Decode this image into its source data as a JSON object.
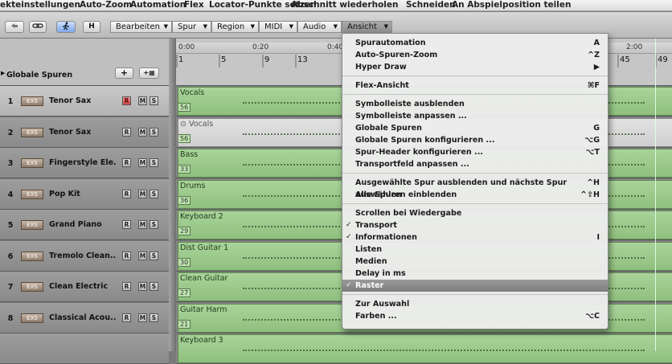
{
  "menubar": [
    "ekteinstellungen",
    "Auto-Zoom",
    "Automation",
    "Flex",
    "Locator-Punkte setzen",
    "Abschnitt wiederholen",
    "Schneiden",
    "An Abspielposition teilen"
  ],
  "toolbar": {
    "h_label": "H",
    "menus": [
      "Bearbeiten",
      "Spur",
      "Region",
      "MIDI",
      "Audio",
      "Ansicht"
    ]
  },
  "global": {
    "label": "Globale Spuren",
    "plus": "+",
    "grid": "+▦"
  },
  "ruler": {
    "times": [
      "0:00",
      "0:20",
      "0:40",
      "2:00"
    ],
    "bars": [
      "1",
      "5",
      "9",
      "13",
      "45",
      "49"
    ]
  },
  "tracks": [
    {
      "num": "1",
      "name": "Tenor Sax",
      "rec": true,
      "region": "Vocals",
      "rnum": "56",
      "grey": false
    },
    {
      "num": "2",
      "name": "Tenor Sax",
      "rec": false,
      "region": "Vocals",
      "rnum": "56",
      "grey": true
    },
    {
      "num": "3",
      "name": "Fingerstyle Ele...",
      "rec": false,
      "region": "Bass",
      "rnum": "33",
      "grey": false
    },
    {
      "num": "4",
      "name": "Pop Kit",
      "rec": false,
      "region": "Drums",
      "rnum": "36",
      "grey": false
    },
    {
      "num": "5",
      "name": "Grand Piano",
      "rec": false,
      "region": "Keyboard 2",
      "rnum": "29",
      "grey": false
    },
    {
      "num": "6",
      "name": "Tremolo Clean...",
      "rec": false,
      "region": "Dist Guitar 1",
      "rnum": "30",
      "grey": false
    },
    {
      "num": "7",
      "name": "Clean Electric",
      "rec": false,
      "region": "Clean Guitar",
      "rnum": "27",
      "grey": false
    },
    {
      "num": "8",
      "name": "Classical Acou...",
      "rec": false,
      "region": "Guitar Harm",
      "rnum": "21",
      "grey": false
    },
    {
      "num": "",
      "name": "",
      "rec": false,
      "region": "Keyboard 3",
      "rnum": "",
      "grey": false
    }
  ],
  "btn": {
    "r": "R",
    "m": "M",
    "s": "S",
    "exs": "EXS"
  },
  "dropdown": [
    {
      "label": "Spurautomation",
      "sc": "A"
    },
    {
      "label": "Auto-Spuren-Zoom",
      "sc": "^Z"
    },
    {
      "label": "Hyper Draw",
      "sc": "▶"
    },
    {
      "sep": true
    },
    {
      "label": "Flex-Ansicht",
      "sc": "⌘F"
    },
    {
      "sep": true
    },
    {
      "label": "Symbolleiste ausblenden",
      "sc": ""
    },
    {
      "label": "Symbolleiste anpassen ...",
      "sc": ""
    },
    {
      "label": "Globale Spuren",
      "sc": "G"
    },
    {
      "label": "Globale Spuren konfigurieren ...",
      "sc": "⌥G"
    },
    {
      "label": "Spur-Header konfigurieren ...",
      "sc": "⌥T"
    },
    {
      "label": "Transportfeld anpassen ...",
      "sc": ""
    },
    {
      "sep": true
    },
    {
      "label": "Ausgewählte Spur ausblenden und nächste Spur auswählen",
      "sc": "^H"
    },
    {
      "label": "Alle Spuren einblenden",
      "sc": "^⇧H"
    },
    {
      "sep": true
    },
    {
      "label": "Scrollen bei Wiedergabe",
      "sc": ""
    },
    {
      "label": "Transport",
      "sc": "",
      "check": true
    },
    {
      "label": "Informationen",
      "sc": "I",
      "check": true
    },
    {
      "label": "Listen",
      "sc": ""
    },
    {
      "label": "Medien",
      "sc": ""
    },
    {
      "label": "Delay in ms",
      "sc": ""
    },
    {
      "label": "Raster",
      "sc": "",
      "check": true,
      "highlight": true
    },
    {
      "sep": true
    },
    {
      "label": "Zur Auswahl",
      "sc": ""
    },
    {
      "label": "Farben ...",
      "sc": "⌥C"
    }
  ]
}
